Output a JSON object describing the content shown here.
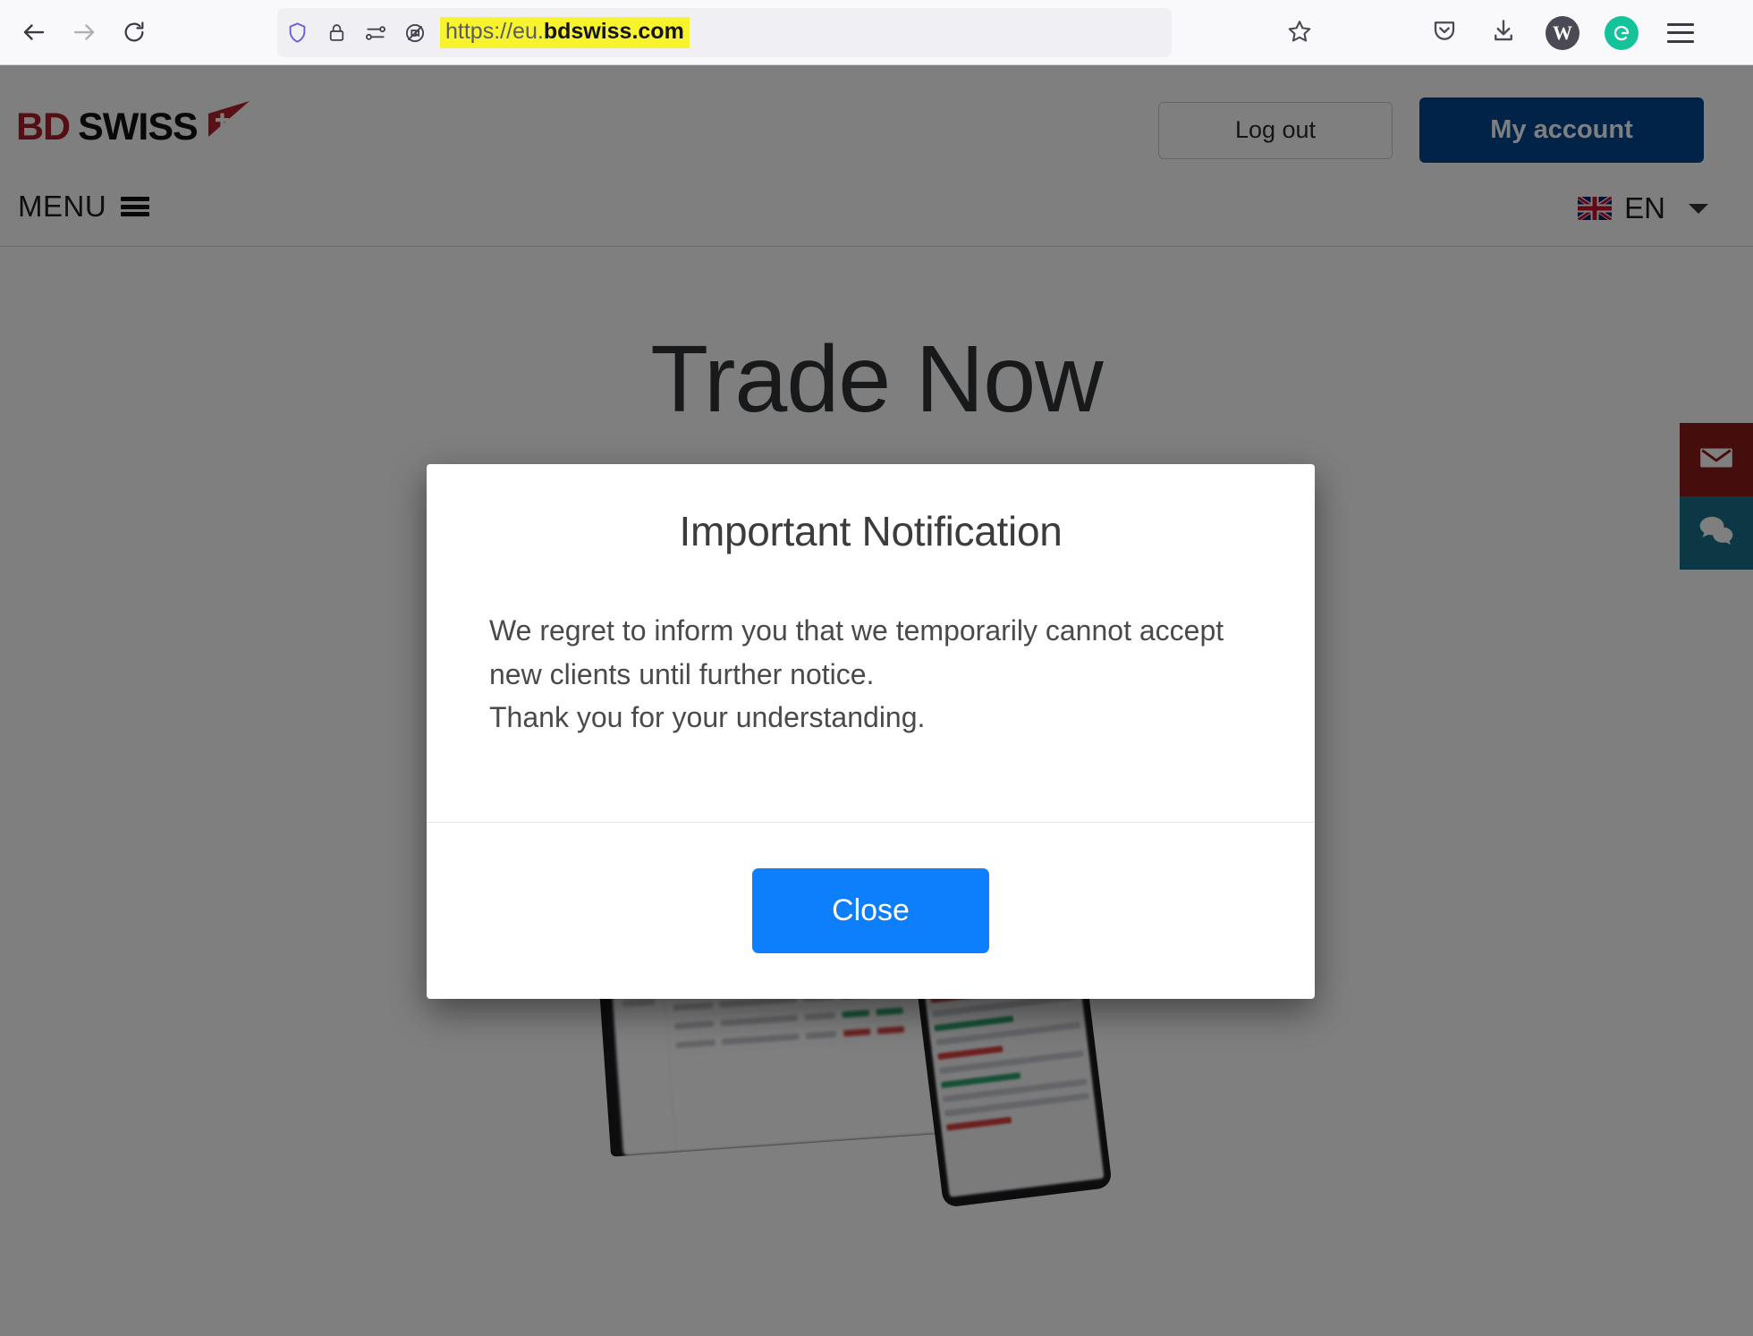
{
  "browser": {
    "back_icon": "back-arrow-icon",
    "forward_icon": "forward-arrow-icon",
    "reload_icon": "reload-icon",
    "shield_icon": "tracking-protection-shield-icon",
    "lock_icon": "padlock-icon",
    "permissions_icon": "site-permissions-icon",
    "blocked_icon": "camera-blocked-icon",
    "url_scheme": "https://",
    "url_subdomain": "eu.",
    "url_domain": "bdswiss.com",
    "url_full": "https://eu.bdswiss.com",
    "url_highlight_color": "#f7f32c",
    "bookmark_icon": "bookmark-star-icon",
    "pocket_icon": "pocket-icon",
    "downloads_icon": "downloads-icon",
    "account_avatar_letter": "W",
    "grammarly_icon": "grammarly-icon",
    "grammarly_color": "#15c39a",
    "app_menu_icon": "hamburger-menu-icon"
  },
  "site": {
    "logo": {
      "part1": "BD",
      "part2": "SWISS",
      "part1_color": "#a81f28",
      "part2_color": "#111111",
      "mark": "swiss-arrow-mark"
    },
    "header": {
      "logout_label": "Log out",
      "account_label": "My account",
      "account_button_color": "#00478f"
    },
    "nav": {
      "menu_label": "MENU",
      "menu_icon": "hamburger-menu-icon",
      "language_code": "EN",
      "language_flag": "uk-flag-icon",
      "language_chevron": "chevron-down-icon"
    },
    "hero": {
      "title": "Trade Now",
      "device_image": "trading-platform-devices-image"
    },
    "side_widgets": [
      {
        "name": "email-widget",
        "icon": "envelope-icon",
        "color": "#8c1a1a"
      },
      {
        "name": "live-chat-widget",
        "icon": "chat-bubbles-icon",
        "color": "#18708c"
      }
    ]
  },
  "modal": {
    "title": "Important Notification",
    "paragraph_line_1": "We regret to inform you that we temporarily cannot accept",
    "paragraph_line_2": "new clients until further notice.",
    "paragraph_line_3": "Thank you for your understanding.",
    "close_label": "Close",
    "close_button_color": "#0d7ffc"
  }
}
